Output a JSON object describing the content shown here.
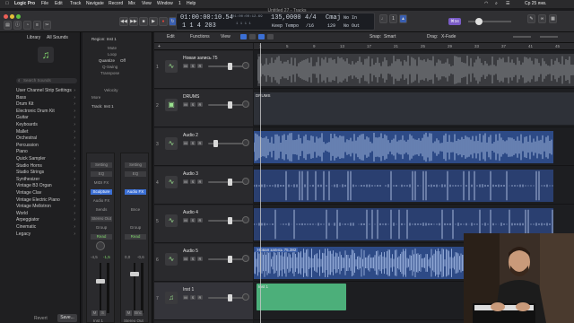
{
  "menubar": {
    "apple_icon": "apple-icon",
    "items": [
      "Logic Pro",
      "File",
      "Edit",
      "Track",
      "Navigate",
      "Record",
      "Mix",
      "View",
      "Window",
      "1",
      "Help"
    ],
    "clock": "Ср 25 янв."
  },
  "window": {
    "title": "Untitled 27 - Tracks"
  },
  "transport": {
    "position_time": "01:00:00:10.54",
    "position_bars": "1  1  4  203",
    "end_time": "01:00:00:12.69",
    "end_bars": "1  1  1  1",
    "tempo": "135,0000",
    "tempo_label": "Keep Tempo",
    "signature": "4/4",
    "division": "/16",
    "key": "Cmaj",
    "key_value": "129",
    "in_label": "No In",
    "out_label": "No Out",
    "cpu_badge": "⌘34"
  },
  "library": {
    "header": "Library",
    "filter": "All Sounds",
    "search_placeholder": "Search Sounds",
    "items": [
      "User Channel Strip Settings",
      "Bass",
      "Drum Kit",
      "Electronic Drum Kit",
      "Guitar",
      "Keyboards",
      "Mallet",
      "Orchestral",
      "Percussion",
      "Piano",
      "Quick Sampler",
      "Studio Horns",
      "Studio Strings",
      "Synthesizer",
      "Vintage B3 Organ",
      "Vintage Clav",
      "Vintage Electric Piano",
      "Vintage Mellotron",
      "World",
      "Arpeggiator",
      "Cinematic",
      "Legacy"
    ],
    "revert": "Revert",
    "save": "Save..."
  },
  "inspector": {
    "region_header": "Region: Inst 1",
    "fields": [
      {
        "label": "Mute",
        "value": ""
      },
      {
        "label": "Loop",
        "value": ""
      },
      {
        "label": "Quantize",
        "value": "Off"
      },
      {
        "label": "Q-Swing",
        "value": ""
      },
      {
        "label": "Transpose",
        "value": ""
      }
    ],
    "more": "More",
    "velocity": "Velocity",
    "track_header": "Track: Inst 1",
    "strip_left": {
      "setting": "Setting",
      "eq": "EQ",
      "midi_fx": "MIDI FX",
      "plugin": "Sculpture",
      "audio_fx": "Audio FX",
      "sends": "Sends",
      "stereo": "Stereo Out",
      "group": "Group",
      "mode": "Read",
      "values": [
        "-4,5",
        "-1,5"
      ],
      "name": "Inst 1",
      "m": "M",
      "s": "S"
    },
    "strip_right": {
      "setting": "Setting",
      "eq": "EQ",
      "audio_fx": "Audio FX",
      "sends": "Bnce",
      "group": "Group",
      "mode": "Read",
      "values": [
        "0,0",
        "-0,6"
      ],
      "name": "Stereo Out",
      "m": "M",
      "s": "Bnc"
    }
  },
  "tracks_toolbar": {
    "edit": "Edit",
    "functions": "Functions",
    "view": "View",
    "snap_label": "Snap:",
    "snap_value": "Smart",
    "drag_label": "Drag:",
    "drag_value": "X-Fade"
  },
  "ruler": [
    "1",
    "5",
    "9",
    "13",
    "17",
    "21",
    "25",
    "29",
    "33",
    "37",
    "41",
    "45"
  ],
  "tracks": [
    {
      "num": "1",
      "name": "Новая запись 75",
      "icon": "waveform-icon"
    },
    {
      "num": "2",
      "name": "DRUMS",
      "icon": "folder-icon"
    },
    {
      "num": "3",
      "name": "Audio 2",
      "icon": "waveform-icon"
    },
    {
      "num": "4",
      "name": "Audio 3",
      "icon": "waveform-icon"
    },
    {
      "num": "5",
      "name": "Audio 4",
      "icon": "waveform-icon"
    },
    {
      "num": "6",
      "name": "Audio 5",
      "icon": "waveform-icon"
    },
    {
      "num": "7",
      "name": "Inst 1",
      "icon": "music-note-icon"
    }
  ],
  "regions": {
    "drums_label": "DRUMS",
    "audio5_label": "Новая запись 75.382",
    "inst_label": "Inst 1"
  },
  "colors": {
    "accent_blue": "#3b6fd4",
    "audio_region_blue": "#4a6fb8",
    "inst_region_green": "#4caf7a",
    "record_red": "#e0443a"
  }
}
